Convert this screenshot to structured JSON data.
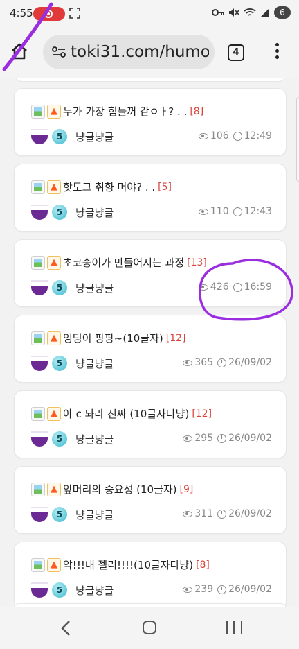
{
  "status_bar": {
    "time": "4:55",
    "battery": "6"
  },
  "browser": {
    "url": "toki31.com/humo",
    "tab_count": "4"
  },
  "posts": [
    {
      "title": "누가 가장 힘들꺼 같ㅇㅏ? . .",
      "comments": "[8]",
      "level": "5",
      "author": "냥글냥글",
      "views": "106",
      "time": "12:49"
    },
    {
      "title": "핫도그 취향 머야? . .",
      "comments": "[5]",
      "level": "5",
      "author": "냥글냥글",
      "views": "110",
      "time": "12:43"
    },
    {
      "title": "초코송이가 만들어지는 과정",
      "comments": "[13]",
      "level": "5",
      "author": "냥글냥글",
      "views": "426",
      "time": "16:59"
    },
    {
      "title": "엉덩이 팡팡~(10글자)",
      "comments": "[12]",
      "level": "5",
      "author": "냥글냥글",
      "views": "365",
      "time": "26/09/02"
    },
    {
      "title": "아 c 놔라 진짜 (10글자다냥)",
      "comments": "[12]",
      "level": "5",
      "author": "냥글냥글",
      "views": "295",
      "time": "26/09/02"
    },
    {
      "title": "앞머리의 중요성 (10글자)",
      "comments": "[9]",
      "level": "5",
      "author": "냥글냥글",
      "views": "311",
      "time": "26/09/02"
    },
    {
      "title": "악!!!내 젤리!!!!(10글자다냥)",
      "comments": "[8]",
      "level": "5",
      "author": "냥글냥글",
      "views": "239",
      "time": "26/09/02"
    }
  ],
  "colors": {
    "comment_count": "#d9443b",
    "annotation": "#9b2de0",
    "record": "#e03a3a"
  }
}
